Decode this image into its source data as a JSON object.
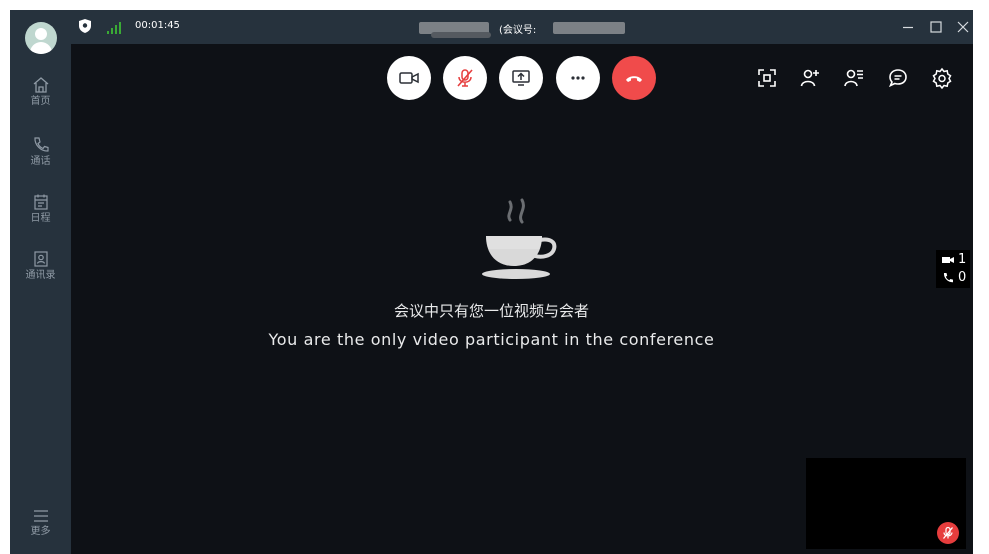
{
  "window": {
    "timer": "00:01:45",
    "meeting_id_label": "(会议号:",
    "controls": [
      "minimize-icon",
      "maximize-icon",
      "close-icon"
    ]
  },
  "sidebar": {
    "items": [
      {
        "label": "首页",
        "icon": "home-icon"
      },
      {
        "label": "通话",
        "icon": "phone-icon"
      },
      {
        "label": "日程",
        "icon": "calendar-icon"
      },
      {
        "label": "通讯录",
        "icon": "contacts-icon"
      }
    ],
    "more_label": "更多"
  },
  "toolbar": {
    "buttons": [
      "video-camera-icon",
      "microphone-muted-icon",
      "share-screen-icon",
      "more-dots-icon",
      "hang-up-icon"
    ],
    "right_icons": [
      "fullscreen-icon",
      "invite-user-icon",
      "participants-list-icon",
      "chat-icon",
      "settings-icon"
    ]
  },
  "main": {
    "message_cn": "会议中只有您一位视频与会者",
    "message_en": "You are the only video participant in the conference"
  },
  "counts": {
    "video": "1",
    "audio": "0"
  },
  "colors": {
    "sidebar_bg": "#26323d",
    "stage_bg": "#0e1116",
    "hangup": "#f04b4b",
    "mute_red": "#e63d3d",
    "signal_green": "#3aaa35"
  }
}
